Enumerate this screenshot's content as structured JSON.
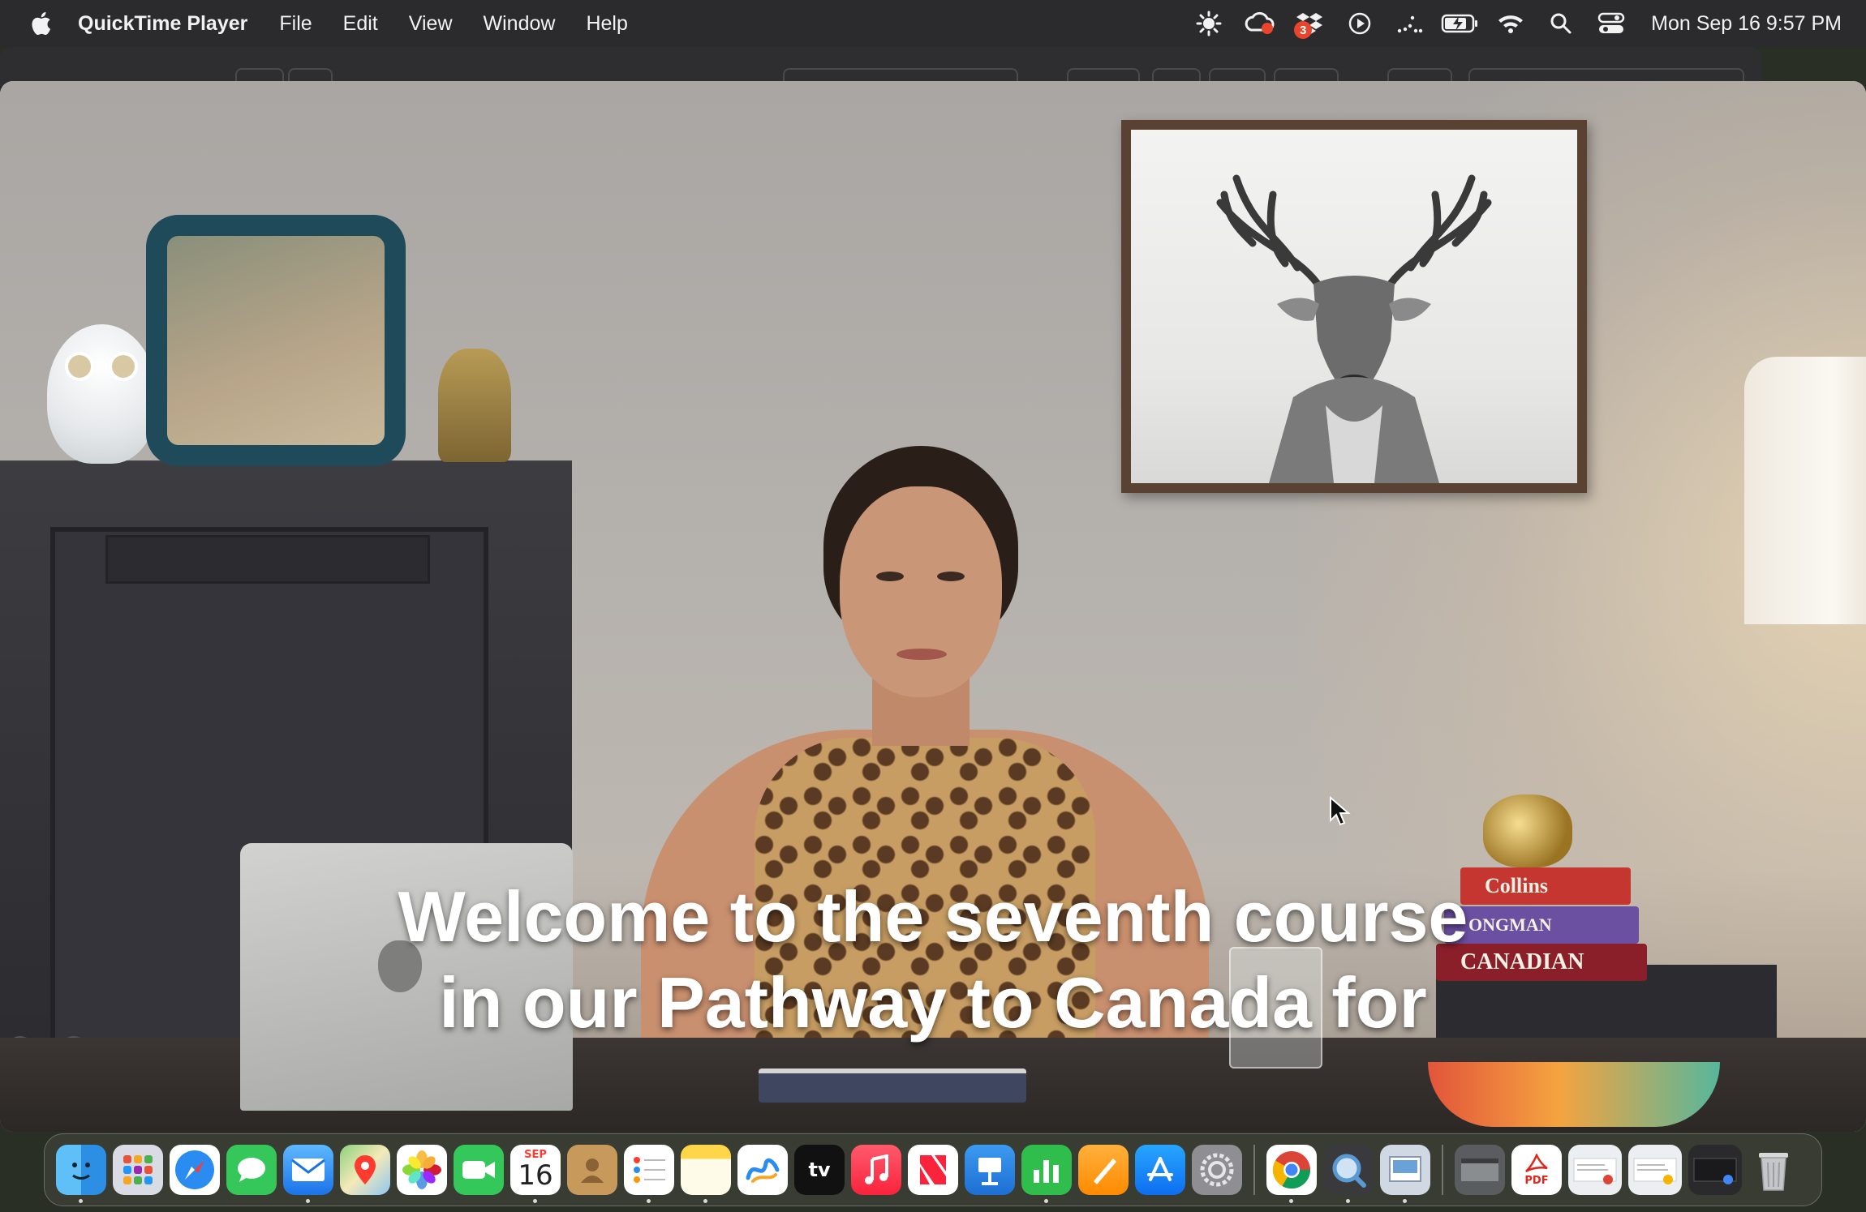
{
  "menubar": {
    "app_name": "QuickTime Player",
    "menus": [
      "File",
      "Edit",
      "View",
      "Window",
      "Help"
    ],
    "clock": "Mon Sep 16  9:57 PM",
    "status_badge": "3",
    "status_icons": [
      "brightness-icon",
      "creative-cloud-icon",
      "dropbox-icon",
      "play-circle-icon",
      "dots-icon",
      "battery-icon",
      "wifi-icon",
      "search-icon",
      "control-center-icon"
    ]
  },
  "video": {
    "subtitle_line1": "Welcome to the seventh course",
    "subtitle_line2": "in our Pathway to Canada for",
    "books": [
      "Collins",
      "ONGMAN",
      "CANADIAN"
    ]
  },
  "dock": {
    "calendar_month": "SEP",
    "calendar_day": "16",
    "tv_label": "tv",
    "pdf_label": "PDF",
    "apps": [
      "Finder",
      "Launchpad",
      "Safari",
      "Messages",
      "Mail",
      "Maps",
      "Photos",
      "FaceTime",
      "Calendar",
      "Contacts",
      "Reminders",
      "Notes",
      "Freeform",
      "TV",
      "Music",
      "News",
      "Keynote",
      "Numbers",
      "Pages",
      "App Store",
      "System Settings",
      "Chrome",
      "QuickTime Player",
      "Preview"
    ]
  },
  "colors": {
    "menubar_bg": "#2b2b2d",
    "subtitle": "#ffffff"
  }
}
